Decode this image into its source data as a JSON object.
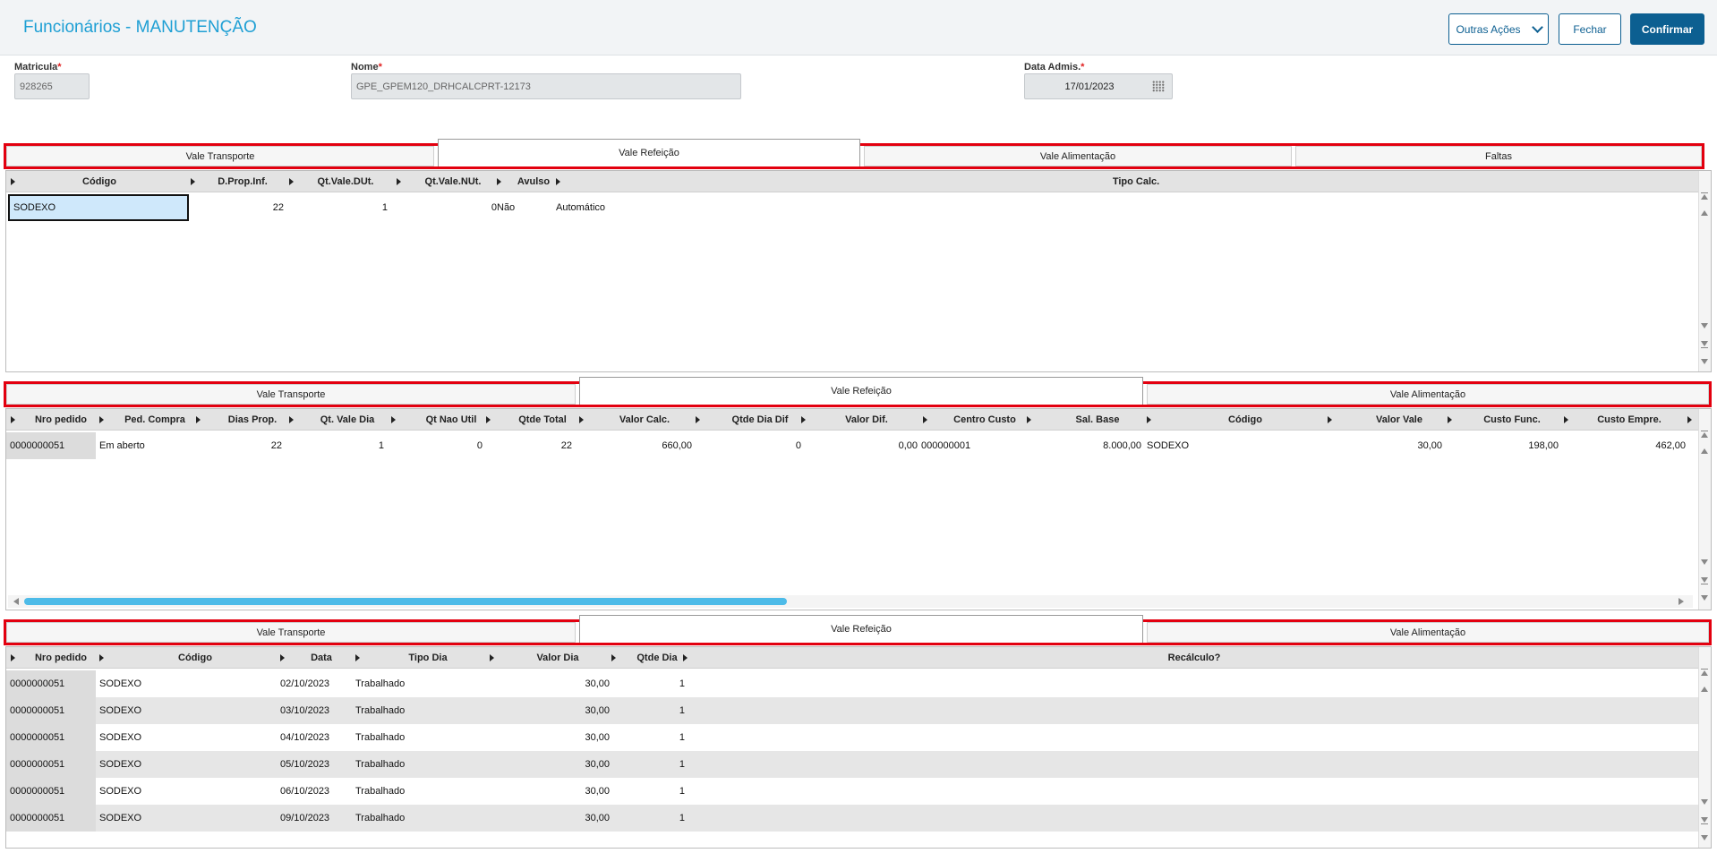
{
  "header": {
    "title": "Funcionários - MANUTENÇÃO",
    "outras_acoes": "Outras Ações",
    "fechar": "Fechar",
    "confirmar": "Confirmar"
  },
  "form": {
    "matricula_label": "Matricula",
    "matricula_value": "928265",
    "nome_label": "Nome",
    "nome_value": "GPE_GPEM120_DRHCALCPRT-12173",
    "data_label": "Data Admis.",
    "data_value": "17/01/2023",
    "required_mark": "*"
  },
  "tabs1": [
    "Vale Transporte",
    "Vale Refeição",
    "Vale Alimentação",
    "Faltas"
  ],
  "tabs2": [
    "Vale Transporte",
    "Vale Refeição",
    "Vale Alimentação"
  ],
  "tabs3": [
    "Vale Transporte",
    "Vale Refeição",
    "Vale Alimentação"
  ],
  "grid1": {
    "columns": [
      "Código",
      "D.Prop.Inf.",
      "Qt.Vale.DUt.",
      "Qt.Vale.NUt.",
      "Avulso",
      "Tipo Calc."
    ],
    "rows": [
      [
        "SODEXO",
        "22",
        "1",
        "0",
        "Não",
        "Automático"
      ]
    ]
  },
  "grid2": {
    "columns": [
      "Nro pedido",
      "Ped. Compra",
      "Dias Prop.",
      "Qt. Vale Dia",
      "Qt Nao Util",
      "Qtde Total",
      "Valor Calc.",
      "Qtde Dia Dif",
      "Valor Dif.",
      "Centro Custo",
      "Sal. Base",
      "Código",
      "Valor Vale",
      "Custo Func.",
      "Custo Empre."
    ],
    "rows": [
      [
        "0000000051",
        "Em aberto",
        "22",
        "1",
        "0",
        "22",
        "660,00",
        "0",
        "0,00",
        "000000001",
        "8.000,00",
        "SODEXO",
        "30,00",
        "198,00",
        "462,00"
      ]
    ]
  },
  "grid3": {
    "columns": [
      "Nro pedido",
      "Código",
      "Data",
      "Tipo Dia",
      "Valor Dia",
      "Qtde Dia",
      "Recálculo?"
    ],
    "rows": [
      [
        "0000000051",
        "SODEXO",
        "02/10/2023",
        "Trabalhado",
        "30,00",
        "1",
        ""
      ],
      [
        "0000000051",
        "SODEXO",
        "03/10/2023",
        "Trabalhado",
        "30,00",
        "1",
        ""
      ],
      [
        "0000000051",
        "SODEXO",
        "04/10/2023",
        "Trabalhado",
        "30,00",
        "1",
        ""
      ],
      [
        "0000000051",
        "SODEXO",
        "05/10/2023",
        "Trabalhado",
        "30,00",
        "1",
        ""
      ],
      [
        "0000000051",
        "SODEXO",
        "06/10/2023",
        "Trabalhado",
        "30,00",
        "1",
        ""
      ],
      [
        "0000000051",
        "SODEXO",
        "09/10/2023",
        "Trabalhado",
        "30,00",
        "1",
        ""
      ]
    ]
  },
  "colors": {
    "title": "#1e9fd4",
    "primary": "#0c5f91",
    "highlight_border": "#e3000f",
    "scroll_thumb": "#4dbbe8"
  }
}
